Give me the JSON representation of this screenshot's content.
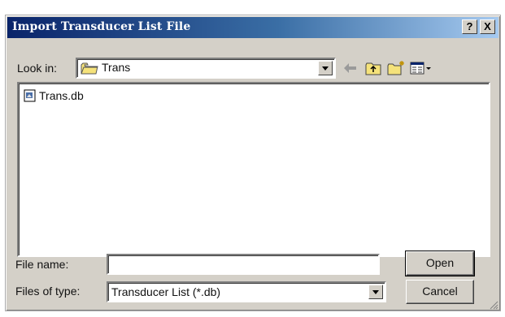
{
  "dialog": {
    "title": "Import Transducer List File",
    "help_button": "?",
    "close_button": "X"
  },
  "lookin": {
    "label": "Look in:",
    "value": "Trans"
  },
  "files": [
    {
      "name": "Trans.db",
      "icon": "database-file-icon"
    }
  ],
  "filename": {
    "label": "File name:",
    "value": "",
    "placeholder": ""
  },
  "filetype": {
    "label": "Files of type:",
    "value": "Transducer List (*.db)"
  },
  "buttons": {
    "open": "Open",
    "cancel": "Cancel"
  },
  "icons": {
    "lookin_folder": "folder-icon",
    "back": "back-arrow-icon",
    "up": "up-folder-icon",
    "new_folder": "new-folder-icon",
    "view_menu": "view-menu-icon"
  },
  "colors": {
    "titlebar_start": "#0a246a",
    "titlebar_end": "#a6caf0",
    "face": "#d4d0c8"
  }
}
